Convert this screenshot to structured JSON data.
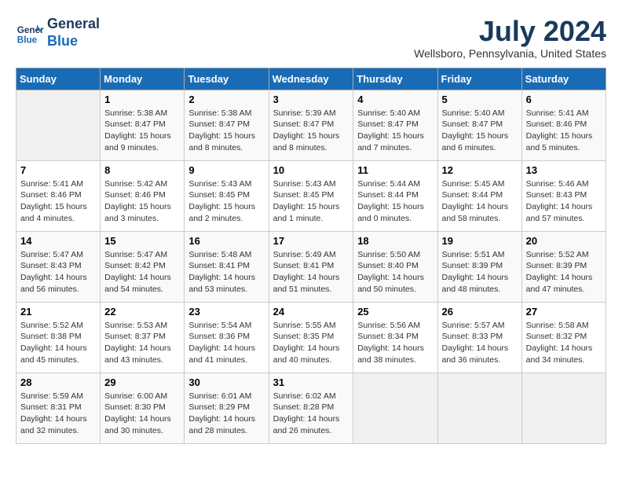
{
  "header": {
    "logo_line1": "General",
    "logo_line2": "Blue",
    "month_year": "July 2024",
    "location": "Wellsboro, Pennsylvania, United States"
  },
  "days_of_week": [
    "Sunday",
    "Monday",
    "Tuesday",
    "Wednesday",
    "Thursday",
    "Friday",
    "Saturday"
  ],
  "weeks": [
    [
      {
        "day": "",
        "info": ""
      },
      {
        "day": "1",
        "info": "Sunrise: 5:38 AM\nSunset: 8:47 PM\nDaylight: 15 hours\nand 9 minutes."
      },
      {
        "day": "2",
        "info": "Sunrise: 5:38 AM\nSunset: 8:47 PM\nDaylight: 15 hours\nand 8 minutes."
      },
      {
        "day": "3",
        "info": "Sunrise: 5:39 AM\nSunset: 8:47 PM\nDaylight: 15 hours\nand 8 minutes."
      },
      {
        "day": "4",
        "info": "Sunrise: 5:40 AM\nSunset: 8:47 PM\nDaylight: 15 hours\nand 7 minutes."
      },
      {
        "day": "5",
        "info": "Sunrise: 5:40 AM\nSunset: 8:47 PM\nDaylight: 15 hours\nand 6 minutes."
      },
      {
        "day": "6",
        "info": "Sunrise: 5:41 AM\nSunset: 8:46 PM\nDaylight: 15 hours\nand 5 minutes."
      }
    ],
    [
      {
        "day": "7",
        "info": "Sunrise: 5:41 AM\nSunset: 8:46 PM\nDaylight: 15 hours\nand 4 minutes."
      },
      {
        "day": "8",
        "info": "Sunrise: 5:42 AM\nSunset: 8:46 PM\nDaylight: 15 hours\nand 3 minutes."
      },
      {
        "day": "9",
        "info": "Sunrise: 5:43 AM\nSunset: 8:45 PM\nDaylight: 15 hours\nand 2 minutes."
      },
      {
        "day": "10",
        "info": "Sunrise: 5:43 AM\nSunset: 8:45 PM\nDaylight: 15 hours\nand 1 minute."
      },
      {
        "day": "11",
        "info": "Sunrise: 5:44 AM\nSunset: 8:44 PM\nDaylight: 15 hours\nand 0 minutes."
      },
      {
        "day": "12",
        "info": "Sunrise: 5:45 AM\nSunset: 8:44 PM\nDaylight: 14 hours\nand 58 minutes."
      },
      {
        "day": "13",
        "info": "Sunrise: 5:46 AM\nSunset: 8:43 PM\nDaylight: 14 hours\nand 57 minutes."
      }
    ],
    [
      {
        "day": "14",
        "info": "Sunrise: 5:47 AM\nSunset: 8:43 PM\nDaylight: 14 hours\nand 56 minutes."
      },
      {
        "day": "15",
        "info": "Sunrise: 5:47 AM\nSunset: 8:42 PM\nDaylight: 14 hours\nand 54 minutes."
      },
      {
        "day": "16",
        "info": "Sunrise: 5:48 AM\nSunset: 8:41 PM\nDaylight: 14 hours\nand 53 minutes."
      },
      {
        "day": "17",
        "info": "Sunrise: 5:49 AM\nSunset: 8:41 PM\nDaylight: 14 hours\nand 51 minutes."
      },
      {
        "day": "18",
        "info": "Sunrise: 5:50 AM\nSunset: 8:40 PM\nDaylight: 14 hours\nand 50 minutes."
      },
      {
        "day": "19",
        "info": "Sunrise: 5:51 AM\nSunset: 8:39 PM\nDaylight: 14 hours\nand 48 minutes."
      },
      {
        "day": "20",
        "info": "Sunrise: 5:52 AM\nSunset: 8:39 PM\nDaylight: 14 hours\nand 47 minutes."
      }
    ],
    [
      {
        "day": "21",
        "info": "Sunrise: 5:52 AM\nSunset: 8:38 PM\nDaylight: 14 hours\nand 45 minutes."
      },
      {
        "day": "22",
        "info": "Sunrise: 5:53 AM\nSunset: 8:37 PM\nDaylight: 14 hours\nand 43 minutes."
      },
      {
        "day": "23",
        "info": "Sunrise: 5:54 AM\nSunset: 8:36 PM\nDaylight: 14 hours\nand 41 minutes."
      },
      {
        "day": "24",
        "info": "Sunrise: 5:55 AM\nSunset: 8:35 PM\nDaylight: 14 hours\nand 40 minutes."
      },
      {
        "day": "25",
        "info": "Sunrise: 5:56 AM\nSunset: 8:34 PM\nDaylight: 14 hours\nand 38 minutes."
      },
      {
        "day": "26",
        "info": "Sunrise: 5:57 AM\nSunset: 8:33 PM\nDaylight: 14 hours\nand 36 minutes."
      },
      {
        "day": "27",
        "info": "Sunrise: 5:58 AM\nSunset: 8:32 PM\nDaylight: 14 hours\nand 34 minutes."
      }
    ],
    [
      {
        "day": "28",
        "info": "Sunrise: 5:59 AM\nSunset: 8:31 PM\nDaylight: 14 hours\nand 32 minutes."
      },
      {
        "day": "29",
        "info": "Sunrise: 6:00 AM\nSunset: 8:30 PM\nDaylight: 14 hours\nand 30 minutes."
      },
      {
        "day": "30",
        "info": "Sunrise: 6:01 AM\nSunset: 8:29 PM\nDaylight: 14 hours\nand 28 minutes."
      },
      {
        "day": "31",
        "info": "Sunrise: 6:02 AM\nSunset: 8:28 PM\nDaylight: 14 hours\nand 26 minutes."
      },
      {
        "day": "",
        "info": ""
      },
      {
        "day": "",
        "info": ""
      },
      {
        "day": "",
        "info": ""
      }
    ]
  ]
}
